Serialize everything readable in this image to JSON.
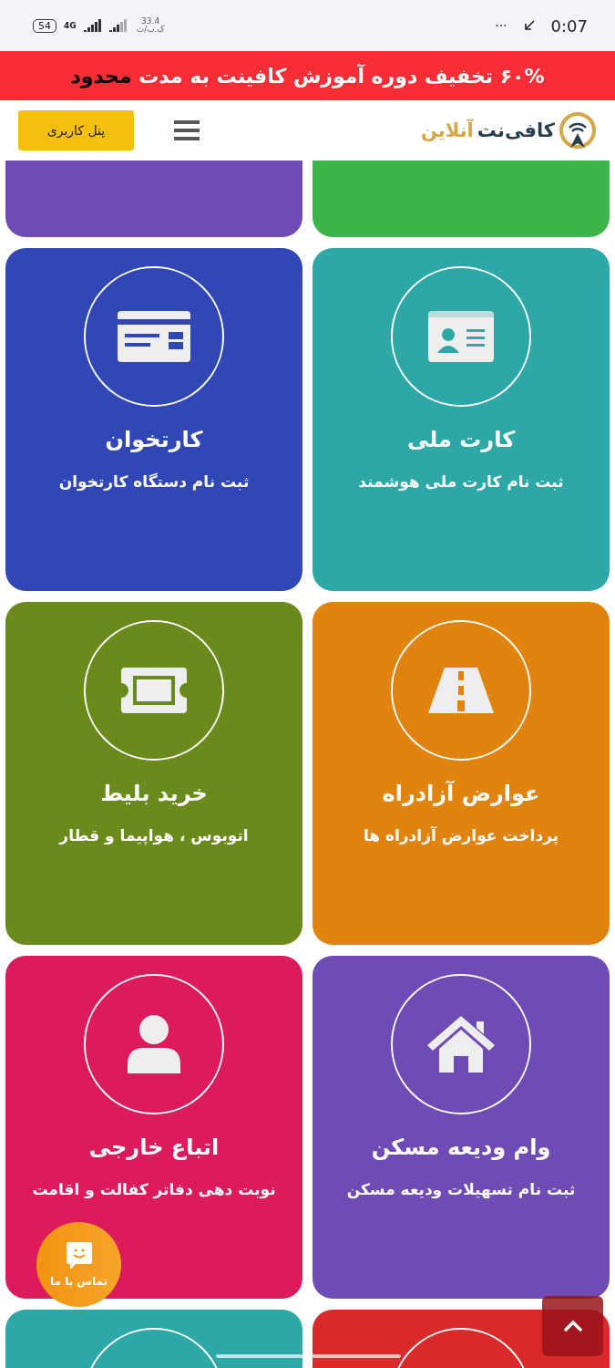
{
  "status_bar": {
    "battery": "54",
    "network": "4G",
    "speed": "33.4",
    "speed_unit": "ک.ب/ث",
    "more": "···",
    "time": "0:07"
  },
  "promo_banner": {
    "text": "۶۰% تخفیف دوره آموزش کافینت به مدت **محدود**"
  },
  "header": {
    "logo_main": "کافی‌نت",
    "logo_accent": "آنلاین",
    "panel_button": "پنل کاربری"
  },
  "cards": [
    {
      "kind": "stub",
      "color": "#3cb54a"
    },
    {
      "kind": "stub",
      "color": "#6f4bb6"
    },
    {
      "kind": "full",
      "color": "#2ea7a7",
      "title": "کارت ملی",
      "subtitle": "ثبت نام کارت ملی هوشمند"
    },
    {
      "kind": "full",
      "color": "#3047b5",
      "title": "کارتخوان",
      "subtitle": "ثبت نام دستگاه کارتخوان"
    },
    {
      "kind": "full",
      "color": "#e0830f",
      "title": "عوارض آزادراه",
      "subtitle": "پرداخت عوارض آزادراه ها"
    },
    {
      "kind": "full",
      "color": "#6a8a1b",
      "title": "خرید بلیط",
      "subtitle": "اتوبوس ، هواپیما و قطار"
    },
    {
      "kind": "full",
      "color": "#6f4bb6",
      "title": "وام ودیعه مسکن",
      "subtitle": "ثبت نام تسهیلات ودیعه مسکن"
    },
    {
      "kind": "full",
      "color": "#dc1b5c",
      "title": "اتباع خارجی",
      "subtitle": "نوبت دهی دفاتر کفالت و اقامت"
    },
    {
      "kind": "ring",
      "color": "#d92a2a"
    },
    {
      "kind": "ring",
      "color": "#2ea7a7"
    }
  ],
  "contact_button": {
    "label": "تماس با ما"
  }
}
